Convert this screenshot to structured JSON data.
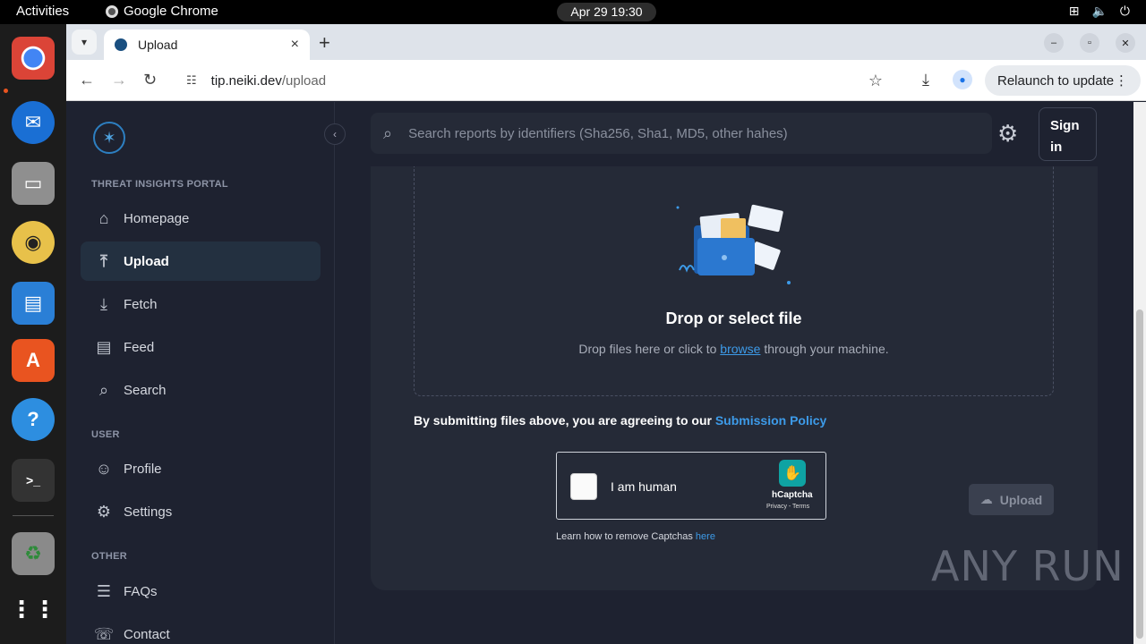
{
  "os": {
    "activities": "Activities",
    "app_name": "Google Chrome",
    "clock": "Apr 29  19:30"
  },
  "browser": {
    "tab_title": "Upload",
    "url_host": "tip.neiki.dev",
    "url_path": "/upload",
    "relaunch_label": "Relaunch to update"
  },
  "sidebar": {
    "section_portal": "THREAT INSIGHTS PORTAL",
    "section_user": "USER",
    "section_other": "OTHER",
    "items": [
      {
        "label": "Homepage",
        "icon": "home-icon"
      },
      {
        "label": "Upload",
        "icon": "upload-icon"
      },
      {
        "label": "Fetch",
        "icon": "download-icon"
      },
      {
        "label": "Feed",
        "icon": "feed-icon"
      },
      {
        "label": "Search",
        "icon": "search-icon"
      },
      {
        "label": "Profile",
        "icon": "profile-icon"
      },
      {
        "label": "Settings",
        "icon": "gear-icon"
      },
      {
        "label": "FAQs",
        "icon": "faq-icon"
      },
      {
        "label": "Contact",
        "icon": "contact-icon"
      }
    ]
  },
  "header": {
    "search_placeholder": "Search reports by identifiers (Sha256, Sha1, MD5, other hahes)",
    "signin_label": "Sign in"
  },
  "upload": {
    "title": "Drop or select file",
    "sub_before": "Drop files here or click to ",
    "sub_link": "browse",
    "sub_after": " through your machine.",
    "policy_text": "By submitting files above, you are agreeing to our ",
    "policy_link": "Submission Policy",
    "captcha_label": "I am human",
    "captcha_brand": "hCaptcha",
    "captcha_terms": "Privacy - Terms",
    "learn_text": "Learn how to remove Captchas ",
    "learn_link": "here",
    "upload_button": "Upload"
  },
  "watermark": "ANY RUN",
  "colors": {
    "accent": "#3d9be9",
    "page_bg": "#1e2230",
    "card_bg": "#252a37"
  }
}
